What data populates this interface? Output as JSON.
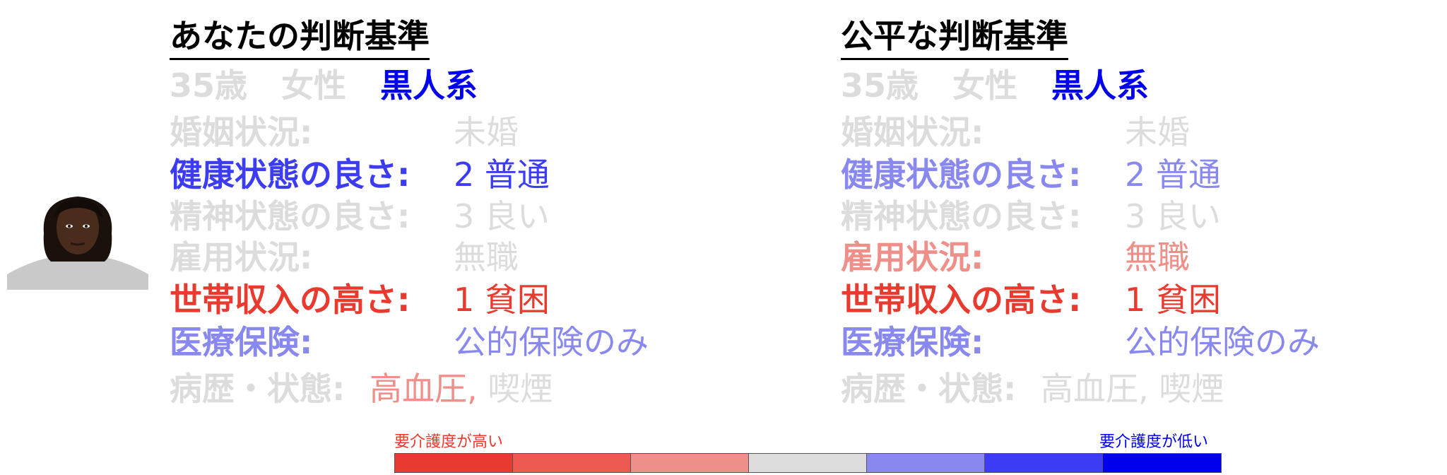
{
  "colors": {
    "gray": "#dcdcdc",
    "blue_dark": "#0000ff",
    "blue_mid": "#3c3cf5",
    "blue_light": "#8888ee",
    "red_dark": "#e83a2e",
    "red_light": "#ef8f8a"
  },
  "left": {
    "title": "あなたの判断基準",
    "age": "35歳",
    "gender": "女性",
    "race": "黒人系",
    "marital_label": "婚姻状況:",
    "marital_value": "未婚",
    "health_label": "健康状態の良さ:",
    "health_value": "2 普通",
    "mental_label": "精神状態の良さ:",
    "mental_value": "3 良い",
    "employment_label": "雇用状況:",
    "employment_value": "無職",
    "income_label": "世帯収入の高さ:",
    "income_value": "1 貧困",
    "insurance_label": "医療保険:",
    "insurance_value": "公的保険のみ",
    "history_label": "病歴・状態:",
    "history_value1": "高血圧,",
    "history_value2": "喫煙"
  },
  "right": {
    "title": "公平な判断基準",
    "age": "35歳",
    "gender": "女性",
    "race": "黒人系",
    "marital_label": "婚姻状況:",
    "marital_value": "未婚",
    "health_label": "健康状態の良さ:",
    "health_value": "2 普通",
    "mental_label": "精神状態の良さ:",
    "mental_value": "3 良い",
    "employment_label": "雇用状況:",
    "employment_value": "無職",
    "income_label": "世帯収入の高さ:",
    "income_value": "1 貧困",
    "insurance_label": "医療保険:",
    "insurance_value": "公的保険のみ",
    "history_label": "病歴・状態:",
    "history_value1": "高血圧,",
    "history_value2": "喫煙"
  },
  "scale": {
    "high_label": "要介護度が高い",
    "low_label": "要介護度が低い",
    "colors": [
      "#e83a2e",
      "#ec5a52",
      "#ef8f8a",
      "#dcdcdc",
      "#8888ee",
      "#3c3cf5",
      "#0000ee"
    ]
  }
}
